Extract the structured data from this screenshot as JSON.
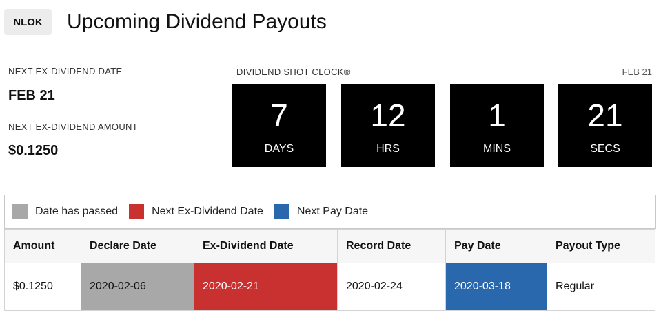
{
  "header": {
    "ticker": "NLOK",
    "title": "Upcoming Dividend Payouts"
  },
  "summary": {
    "next_ex_date_label": "NEXT EX-DIVIDEND DATE",
    "next_ex_date_value": "FEB 21",
    "next_ex_amount_label": "NEXT EX-DIVIDEND AMOUNT",
    "next_ex_amount_value": "$0.1250"
  },
  "shot_clock": {
    "label": "DIVIDEND SHOT CLOCK®",
    "date": "FEB 21",
    "units": [
      {
        "value": "7",
        "unit": "DAYS"
      },
      {
        "value": "12",
        "unit": "HRS"
      },
      {
        "value": "1",
        "unit": "MINS"
      },
      {
        "value": "21",
        "unit": "SECS"
      }
    ]
  },
  "legend": [
    {
      "label": "Date has passed",
      "color": "#a8a8a8"
    },
    {
      "label": "Next Ex-Dividend Date",
      "color": "#c93131"
    },
    {
      "label": "Next Pay Date",
      "color": "#2a68ae"
    }
  ],
  "table": {
    "headers": [
      "Amount",
      "Declare Date",
      "Ex-Dividend Date",
      "Record Date",
      "Pay Date",
      "Payout Type"
    ],
    "rows": [
      [
        "$0.1250",
        "2020-02-06",
        "2020-02-21",
        "2020-02-24",
        "2020-03-18",
        "Regular"
      ]
    ]
  },
  "colors": {
    "passed": "#a8a8a8",
    "ex_dividend": "#c93131",
    "pay": "#2a68ae"
  }
}
